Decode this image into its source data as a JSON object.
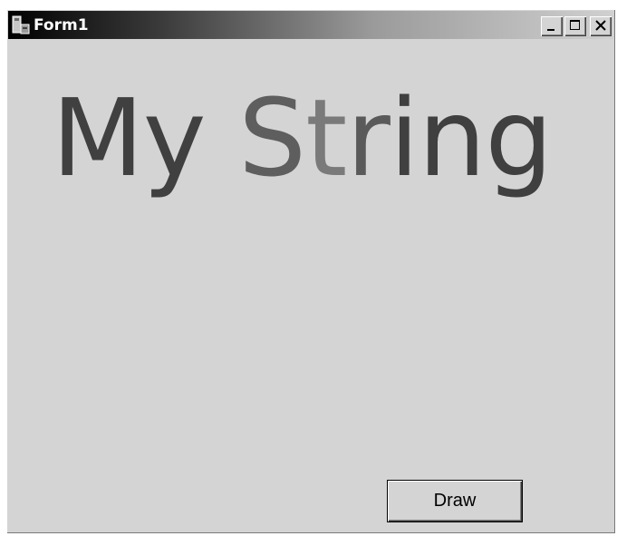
{
  "window": {
    "title": "Form1",
    "title_icon": "form-app-icon",
    "controls": {
      "minimize_icon": "minimize-icon",
      "maximize_icon": "maximize-icon",
      "close_icon": "close-icon"
    }
  },
  "canvas": {
    "text_parts": [
      "My ",
      "S",
      "t",
      "r",
      "ing"
    ],
    "colors": [
      "#404040",
      "#5e5e5e",
      "#7a7a7a",
      "#5a5a5a",
      "#404040"
    ]
  },
  "button": {
    "label": "Draw"
  },
  "colors": {
    "form_background": "#d4d4d4",
    "title_gradient_start": "#000000",
    "title_gradient_end": "#d0d0d0"
  }
}
